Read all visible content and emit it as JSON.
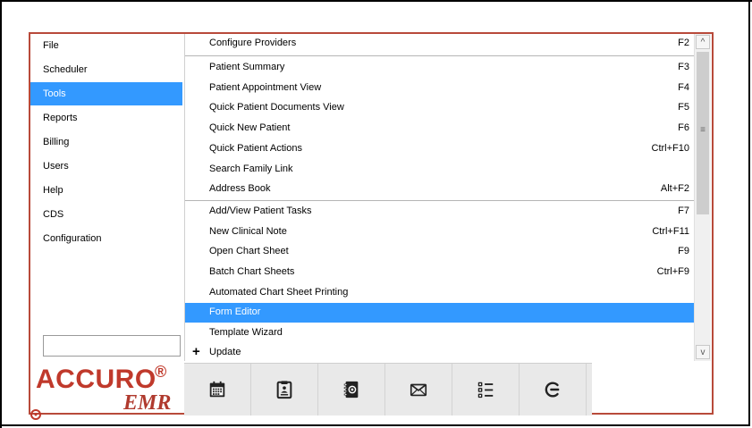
{
  "sidebar": {
    "items": [
      {
        "label": "File",
        "selected": false
      },
      {
        "label": "Scheduler",
        "selected": false
      },
      {
        "label": "Tools",
        "selected": true
      },
      {
        "label": "Reports",
        "selected": false
      },
      {
        "label": "Billing",
        "selected": false
      },
      {
        "label": "Users",
        "selected": false
      },
      {
        "label": "Help",
        "selected": false
      },
      {
        "label": "CDS",
        "selected": false
      },
      {
        "label": "Configuration",
        "selected": false
      }
    ],
    "search": {
      "value": "",
      "placeholder": ""
    }
  },
  "logo": {
    "brand": "ACCURO",
    "registered": "®",
    "product": "EMR"
  },
  "tools_menu": {
    "items": [
      {
        "label": "Configure Providers",
        "shortcut": "F2"
      },
      {
        "label": "Patient Summary",
        "shortcut": "F3"
      },
      {
        "label": "Patient Appointment View",
        "shortcut": "F4"
      },
      {
        "label": "Quick Patient Documents View",
        "shortcut": "F5"
      },
      {
        "label": "Quick New Patient",
        "shortcut": "F6"
      },
      {
        "label": "Quick Patient Actions",
        "shortcut": "Ctrl+F10"
      },
      {
        "label": "Search Family Link",
        "shortcut": ""
      },
      {
        "label": "Address Book",
        "shortcut": "Alt+F2"
      },
      {
        "label": "Add/View Patient Tasks",
        "shortcut": "F7"
      },
      {
        "label": "New Clinical Note",
        "shortcut": "Ctrl+F11"
      },
      {
        "label": "Open Chart Sheet",
        "shortcut": "F9"
      },
      {
        "label": "Batch Chart Sheets",
        "shortcut": "Ctrl+F9"
      },
      {
        "label": "Automated Chart Sheet Printing",
        "shortcut": ""
      },
      {
        "label": "Form Editor",
        "shortcut": "",
        "selected": true
      },
      {
        "label": "Template Wizard",
        "shortcut": ""
      },
      {
        "label": "Update",
        "shortcut": "",
        "expandable": true,
        "expander": "+"
      }
    ]
  },
  "scrollbar": {
    "up": "^",
    "down": "v",
    "grip": "≡"
  },
  "toolbar": {
    "buttons": [
      {
        "icon": "calendar-icon"
      },
      {
        "icon": "clipboard-icon"
      },
      {
        "icon": "address-book-icon"
      },
      {
        "icon": "envelope-icon"
      },
      {
        "icon": "task-list-icon"
      },
      {
        "icon": "logout-icon"
      }
    ]
  },
  "colors": {
    "accent": "#3399ff",
    "brand": "#c0392b",
    "frame": "#b84a3a"
  }
}
